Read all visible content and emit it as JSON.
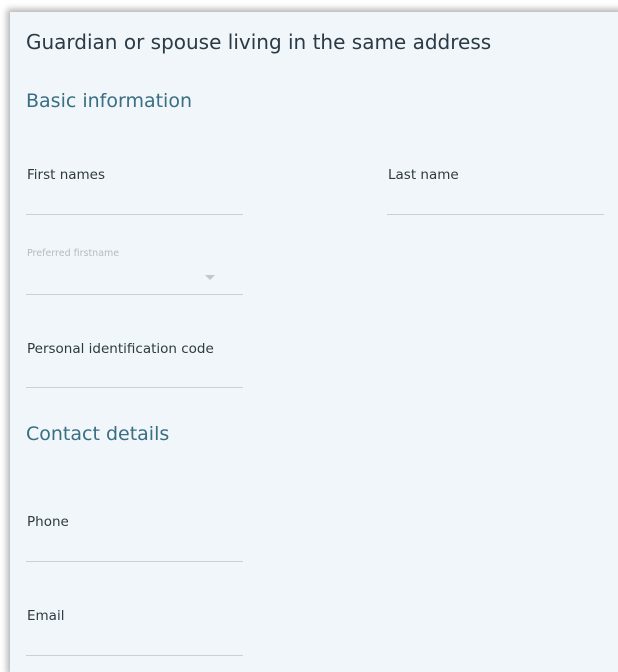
{
  "form": {
    "title": "Guardian or spouse living in the same address",
    "sections": {
      "basic": "Basic information",
      "contact": "Contact details"
    },
    "fields": {
      "first_names": {
        "label": "First names",
        "value": ""
      },
      "last_name": {
        "label": "Last name",
        "value": ""
      },
      "preferred_firstname": {
        "label": "Preferred firstname",
        "selected": ""
      },
      "personal_id": {
        "label": "Personal identification code",
        "value": ""
      },
      "phone": {
        "label": "Phone",
        "value": ""
      },
      "email": {
        "label": "Email",
        "value": ""
      }
    }
  },
  "icons": {
    "preferred_dropdown": "chevron-down-icon"
  },
  "colors": {
    "panel_background": "#f0f6f9",
    "title_text": "#2b3a45",
    "section_heading": "#3a6e82",
    "field_underline": "#c7d2d8",
    "disabled_label": "#b3bcc1"
  }
}
